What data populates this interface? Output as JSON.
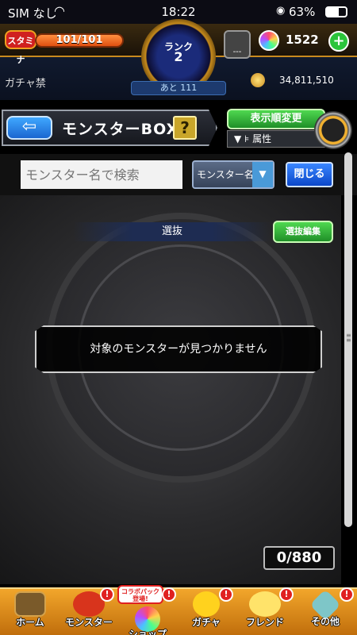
{
  "status_bar": {
    "carrier": "SIM なし",
    "time": "18:22",
    "battery": "63%"
  },
  "header": {
    "stamina_label": "スタミナ",
    "stamina_value": "101/101",
    "rank_label": "ランク",
    "rank_value": "2",
    "rank_remaining": "あと 111",
    "helper_text": "---",
    "orb_count": "1522",
    "orb_plus": "+",
    "gacha_ban": "ガチャ禁",
    "gold": "34,811,510"
  },
  "box": {
    "back_arrow": "⇦",
    "title": "モンスターBOX",
    "help_label": "?",
    "sort_label": "表示順変更",
    "filter_label": "属性"
  },
  "search": {
    "placeholder": "モンスター名で検索",
    "select_value": "モンスター名",
    "select_arrow": "▼",
    "close_label": "閉じる"
  },
  "main": {
    "section_title": "選抜",
    "edit_label": "選抜編集",
    "empty_message": "対象のモンスターが見つかりません",
    "count": "0/880"
  },
  "nav": {
    "items": [
      {
        "label": "ホーム",
        "badge": ""
      },
      {
        "label": "モンスター",
        "badge": "!"
      },
      {
        "label": "ショップ",
        "badge": "!"
      },
      {
        "label": "ガチャ",
        "badge": "!"
      },
      {
        "label": "フレンド",
        "badge": "!"
      },
      {
        "label": "その他",
        "badge": "!"
      }
    ],
    "promo": "コラボパック登場!"
  },
  "colors": {
    "accent_green": "#2bc43b",
    "accent_blue": "#1a66d0",
    "nav_orange": "#f2a62b"
  }
}
